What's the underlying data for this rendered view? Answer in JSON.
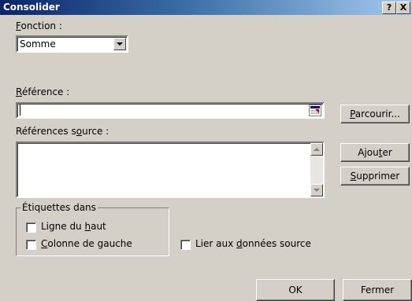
{
  "window": {
    "title": "Consolider",
    "help_label": "?",
    "close_label": "X"
  },
  "function": {
    "label_pre": "",
    "label_u": "F",
    "label_post": "onction :",
    "value": "Somme"
  },
  "reference": {
    "label_pre": "",
    "label_u": "R",
    "label_post": "éférence :",
    "value": ""
  },
  "browse_button": {
    "pre": "",
    "u": "P",
    "post": "arcourir..."
  },
  "source_refs": {
    "label_pre": "Références s",
    "label_u": "o",
    "label_post": "urce :"
  },
  "add_button": {
    "pre": "Ajou",
    "u": "t",
    "post": "er"
  },
  "delete_button": {
    "pre": "",
    "u": "S",
    "post": "upprimer"
  },
  "labels_group": {
    "legend": "Étiquettes dans",
    "top_row": {
      "pre": "Ligne du ",
      "u": "h",
      "post": "aut",
      "checked": false
    },
    "left_column": {
      "pre": "",
      "u": "C",
      "post": "olonne de gauche",
      "checked": false
    }
  },
  "link_source": {
    "pre": "Lier aux ",
    "u": "d",
    "post": "onnées source",
    "checked": false
  },
  "ok_label": "OK",
  "close_label": "Fermer",
  "icons": {
    "collapse": "collapse-dialog-icon",
    "dropdown": "chevron-down-icon",
    "scroll_up": "scroll-up-icon",
    "scroll_down": "scroll-down-icon"
  }
}
